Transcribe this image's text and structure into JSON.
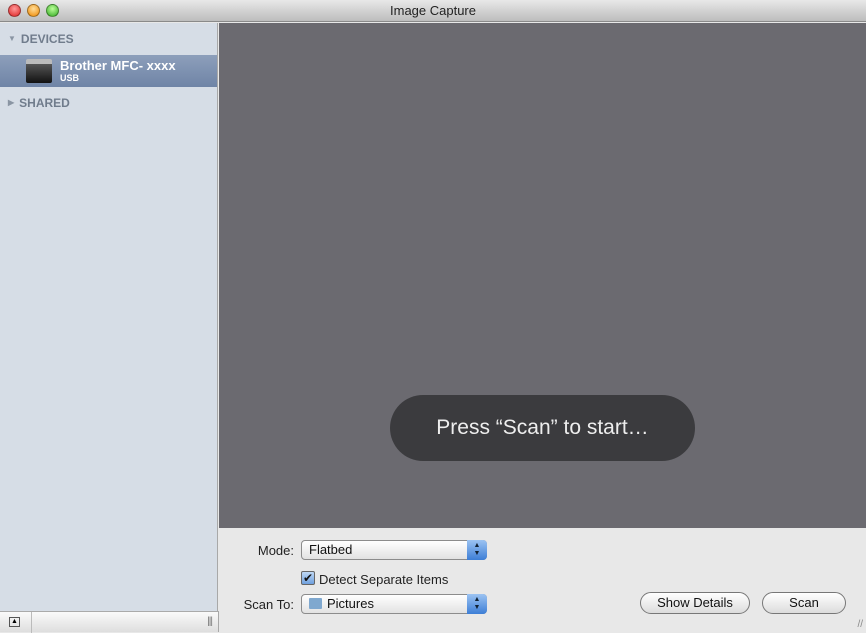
{
  "window": {
    "title": "Image Capture"
  },
  "sidebar": {
    "groups": [
      {
        "label": "DEVICES"
      },
      {
        "label": "SHARED"
      }
    ],
    "devices": [
      {
        "name": "Brother  MFC- xxxx",
        "connection": "USB",
        "icon": "printer-icon"
      }
    ]
  },
  "preview": {
    "hud_text": "Press “Scan” to start…"
  },
  "panel": {
    "mode_label": "Mode:",
    "mode_value": "Flatbed",
    "detect_label": "Detect Separate Items",
    "detect_checked": true,
    "scanto_label": "Scan To:",
    "scanto_value": "Pictures",
    "show_details": "Show Details",
    "scan": "Scan"
  },
  "colors": {
    "accent": "#3d7ed6",
    "preview_bg": "#6b6a70",
    "sidebar_bg": "#d6dde6",
    "selection": "#7a8fb0"
  }
}
